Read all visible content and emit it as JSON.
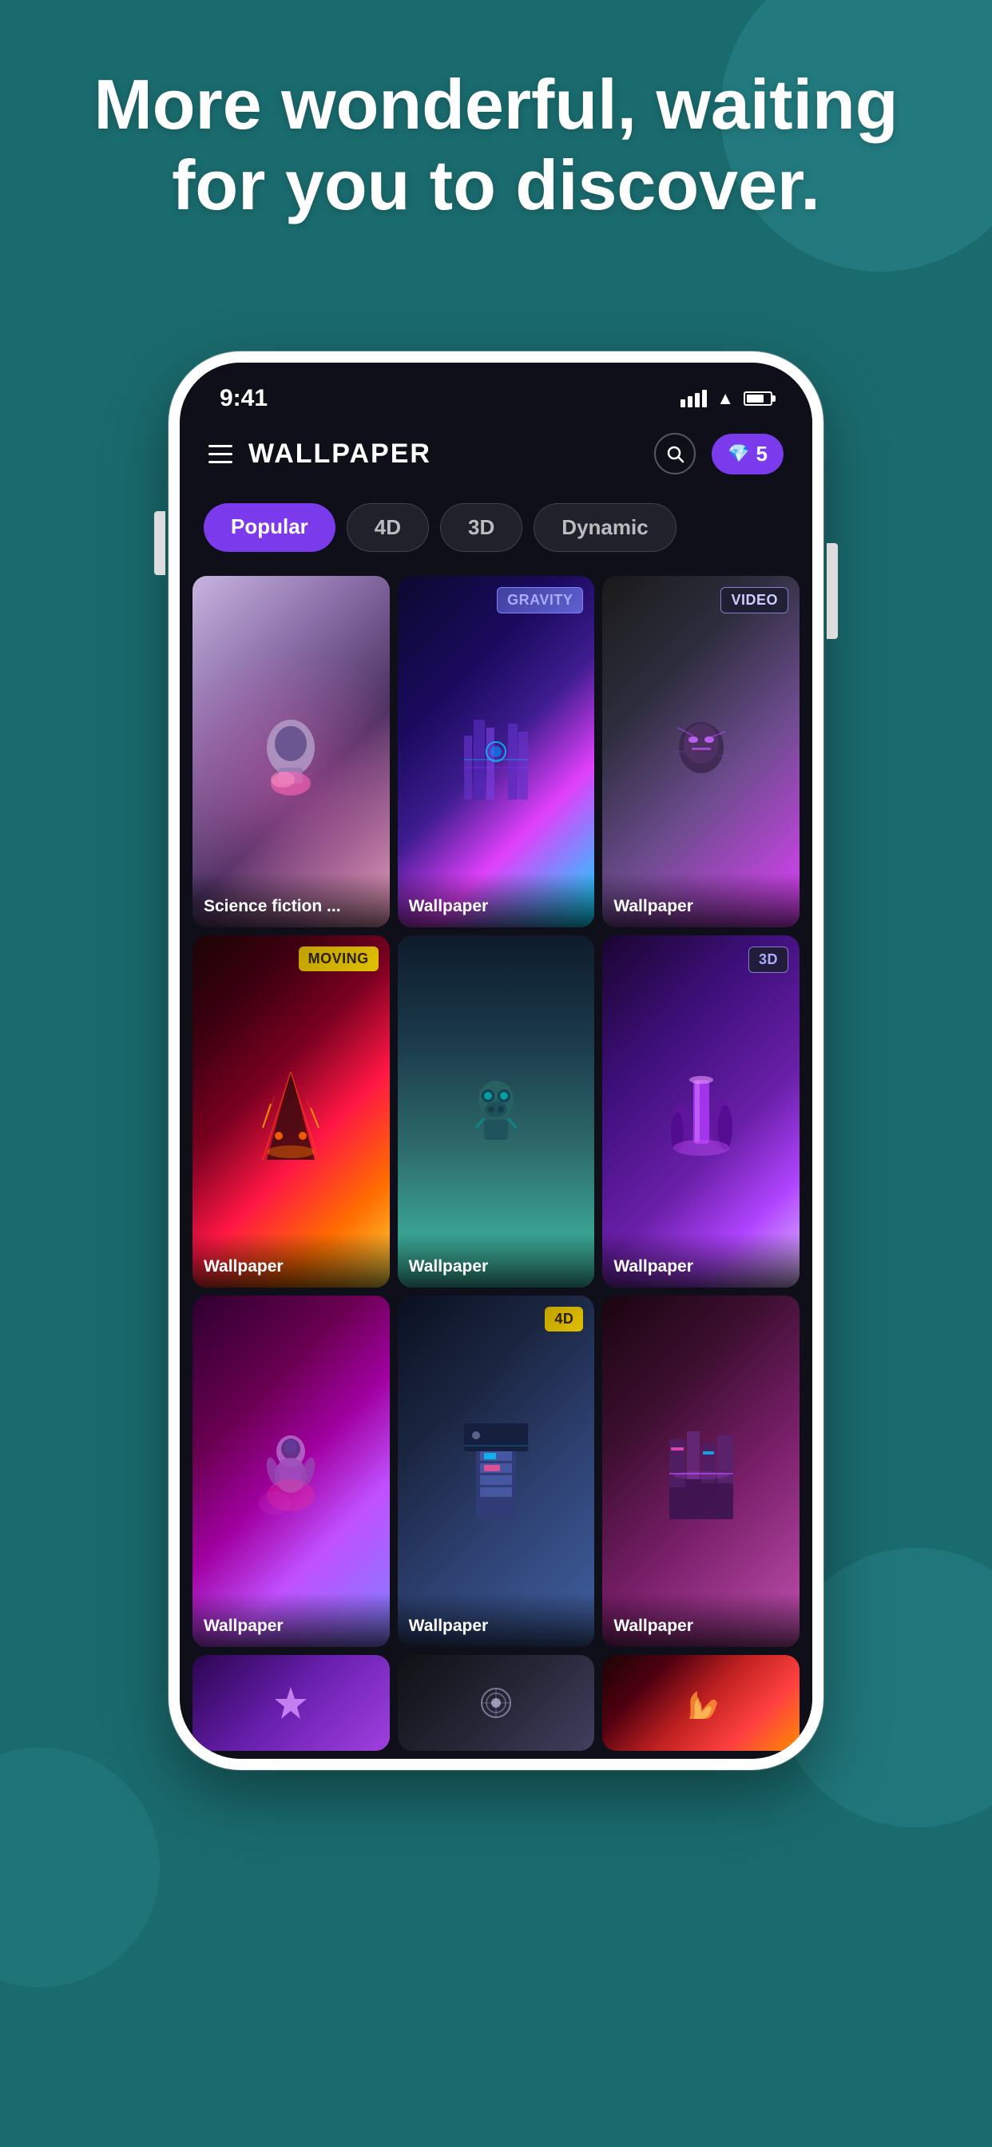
{
  "background": {
    "color": "#1a6b6e"
  },
  "hero": {
    "title": "More wonderful, waiting for you to discover."
  },
  "status_bar": {
    "time": "9:41",
    "signal": "signal",
    "wifi": "wifi",
    "battery": "battery"
  },
  "app_header": {
    "title": "WALLPAPER",
    "search_label": "search",
    "gem_count": "5"
  },
  "tabs": [
    {
      "label": "Popular",
      "active": true
    },
    {
      "label": "4D",
      "active": false
    },
    {
      "label": "3D",
      "active": false
    },
    {
      "label": "Dynamic",
      "active": false
    }
  ],
  "wallpapers": [
    {
      "id": 1,
      "label": "Science fiction ...",
      "badge": null,
      "style": "wp-1"
    },
    {
      "id": 2,
      "label": "Wallpaper",
      "badge": "GRAVITY",
      "badge_type": "gravity",
      "style": "wp-2"
    },
    {
      "id": 3,
      "label": "Wallpaper",
      "badge": "VIDEO",
      "badge_type": "video",
      "style": "wp-3"
    },
    {
      "id": 4,
      "label": "Wallpaper",
      "badge": "MOVING",
      "badge_type": "moving",
      "style": "wp-4"
    },
    {
      "id": 5,
      "label": "Wallpaper",
      "badge": null,
      "style": "wp-5"
    },
    {
      "id": 6,
      "label": "Wallpaper",
      "badge": "3D",
      "badge_type": "3d",
      "style": "wp-6"
    },
    {
      "id": 7,
      "label": "Wallpaper",
      "badge": null,
      "style": "wp-7"
    },
    {
      "id": 8,
      "label": "Wallpaper",
      "badge": "4D",
      "badge_type": "4d",
      "style": "wp-8"
    },
    {
      "id": 9,
      "label": "Wallpaper",
      "badge": null,
      "style": "wp-9"
    }
  ],
  "partial_wallpapers": [
    {
      "id": 10,
      "style": "wp-partial-1"
    },
    {
      "id": 11,
      "style": "wp-partial-2"
    },
    {
      "id": 12,
      "style": "wp-partial-3"
    }
  ]
}
